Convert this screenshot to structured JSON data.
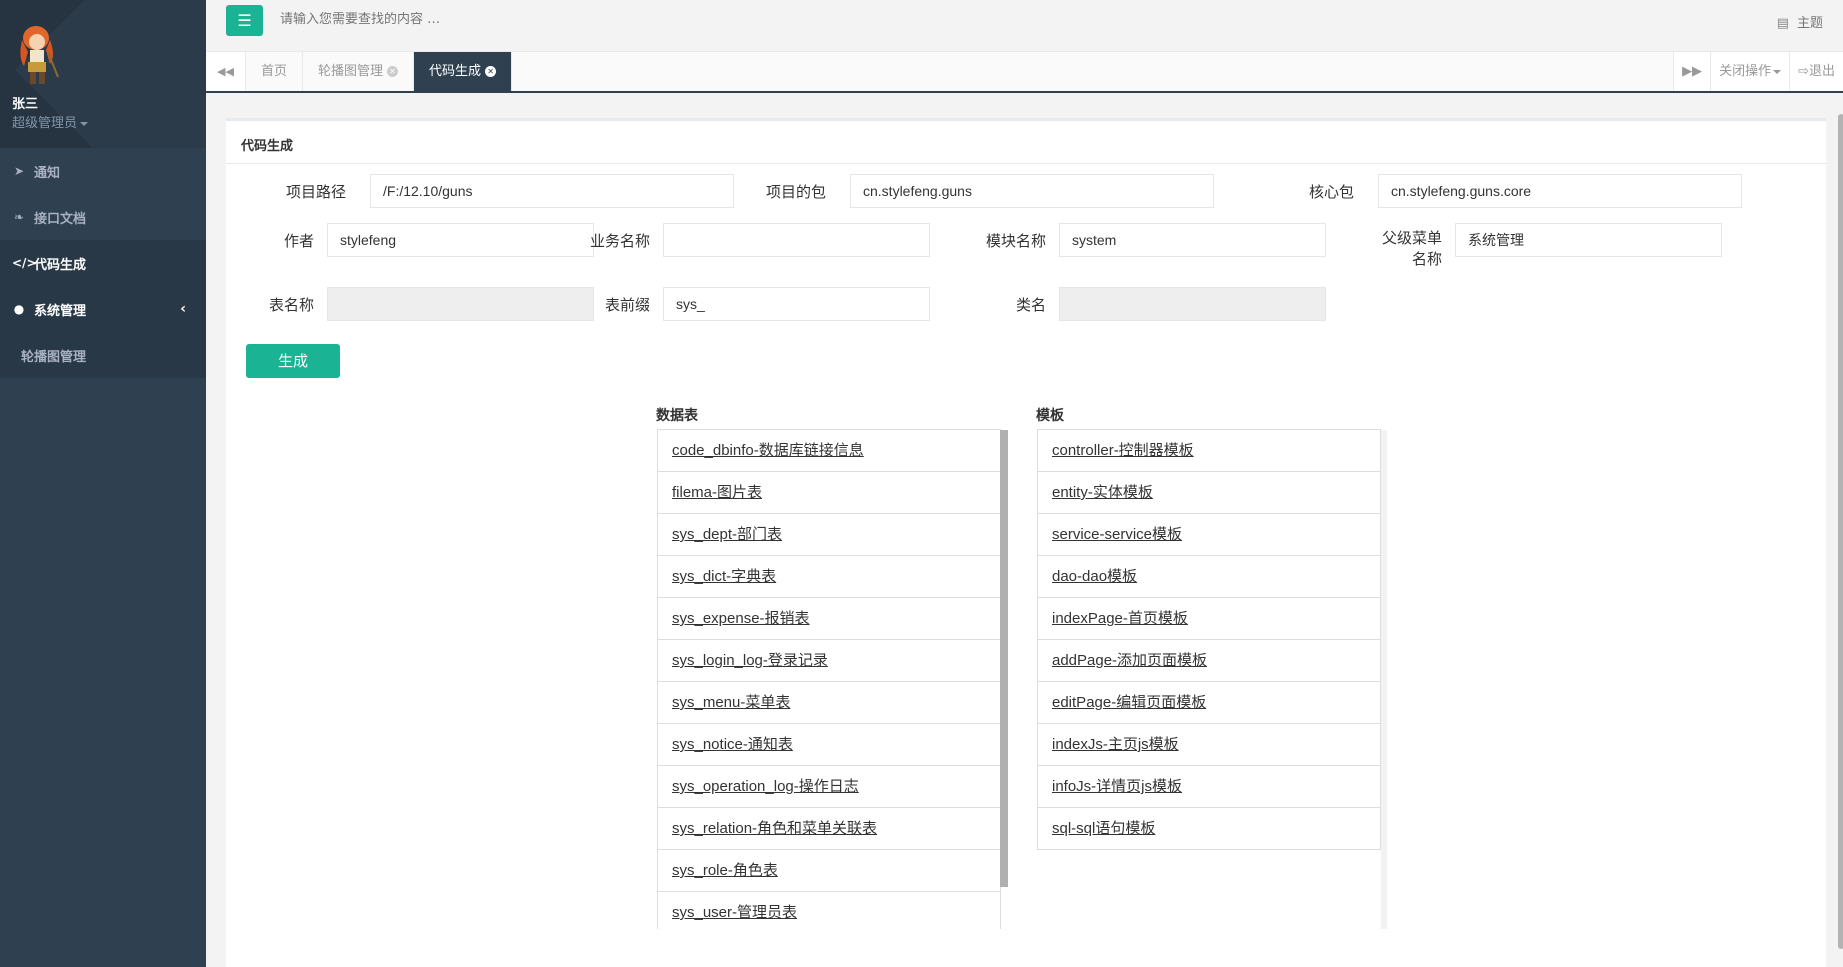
{
  "sidebar": {
    "user_name": "张三",
    "user_role": "超级管理员",
    "items": [
      {
        "label": "通知",
        "icon": "paper-plane-icon"
      },
      {
        "label": "接口文档",
        "icon": "leaf-icon"
      },
      {
        "label": "代码生成",
        "icon": "code-icon"
      },
      {
        "label": "系统管理",
        "icon": "user-icon"
      }
    ],
    "sub_items": [
      {
        "label": "轮播图管理"
      }
    ]
  },
  "topbar": {
    "search_placeholder": "请输入您需要查找的内容 …",
    "theme_label": "主题"
  },
  "tabs": {
    "items": [
      {
        "label": "首页"
      },
      {
        "label": "轮播图管理"
      },
      {
        "label": "代码生成"
      }
    ],
    "close_ops_label": "关闭操作",
    "logout_label": "退出"
  },
  "panel": {
    "title": "代码生成",
    "fields": {
      "project_path": {
        "label": "项目路径",
        "value": "/F:/12.10/guns"
      },
      "project_package": {
        "label": "项目的包",
        "value": "cn.stylefeng.guns"
      },
      "core_package": {
        "label": "核心包",
        "value": "cn.stylefeng.guns.core"
      },
      "author": {
        "label": "作者",
        "value": "stylefeng"
      },
      "biz_name": {
        "label": "业务名称",
        "value": ""
      },
      "module_name": {
        "label": "模块名称",
        "value": "system"
      },
      "parent_menu": {
        "label_line1": "父级菜单",
        "label_line2": "名称",
        "value": "系统管理"
      },
      "table_name": {
        "label": "表名称",
        "value": ""
      },
      "table_prefix": {
        "label": "表前缀",
        "value": "sys_"
      },
      "class_name": {
        "label": "类名",
        "value": ""
      }
    },
    "generate_label": "生成",
    "tables_header": "数据表",
    "templates_header": "模板",
    "tables": [
      "code_dbinfo-数据库链接信息",
      "filema-图片表",
      "sys_dept-部门表",
      "sys_dict-字典表",
      "sys_expense-报销表",
      "sys_login_log-登录记录",
      "sys_menu-菜单表",
      "sys_notice-通知表",
      "sys_operation_log-操作日志",
      "sys_relation-角色和菜单关联表",
      "sys_role-角色表",
      "sys_user-管理员表"
    ],
    "templates": [
      "controller-控制器模板",
      "entity-实体模板",
      "service-service模板",
      "dao-dao模板",
      "indexPage-首页模板",
      "addPage-添加页面模板",
      "editPage-编辑页面模板",
      "indexJs-主页js模板",
      "infoJs-详情页js模板",
      "sql-sql语句模板"
    ]
  },
  "colors": {
    "sidebar_bg": "#2f4050",
    "accent": "#1ab394",
    "content_bg": "#f3f3f4"
  }
}
